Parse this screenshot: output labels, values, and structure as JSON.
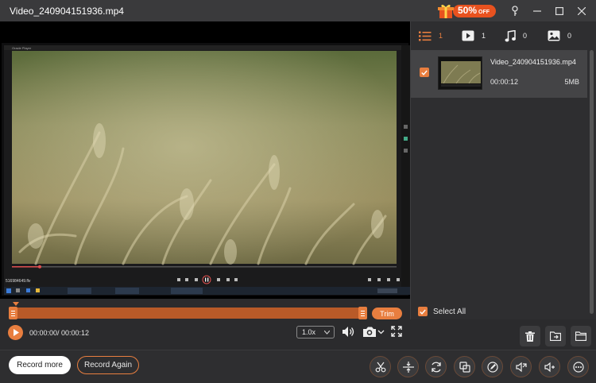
{
  "window": {
    "title": "Video_240904151936.mp4",
    "promo_big": "50%",
    "promo_small": "OFF"
  },
  "player": {
    "caption": "Oracle Player",
    "filename": "516984649.flv"
  },
  "side_tabs": [
    {
      "icon": "list-icon",
      "count": "1"
    },
    {
      "icon": "video-icon",
      "count": "1"
    },
    {
      "icon": "music-icon",
      "count": "0"
    },
    {
      "icon": "image-icon",
      "count": "0"
    }
  ],
  "file": {
    "name": "Video_240904151936.mp4",
    "duration": "00:00:12",
    "size": "5MB",
    "checked": true
  },
  "select_all": "Select All",
  "timeline": {
    "trim_label": "Trim",
    "time": "00:00:00/ 00:00:12",
    "speed": "1.0x"
  },
  "bottom": {
    "record_more": "Record more",
    "record_again": "Record Again"
  },
  "colors": {
    "accent": "#e87e3f",
    "bg": "#2b2b2d",
    "panel": "#2e2e30"
  }
}
